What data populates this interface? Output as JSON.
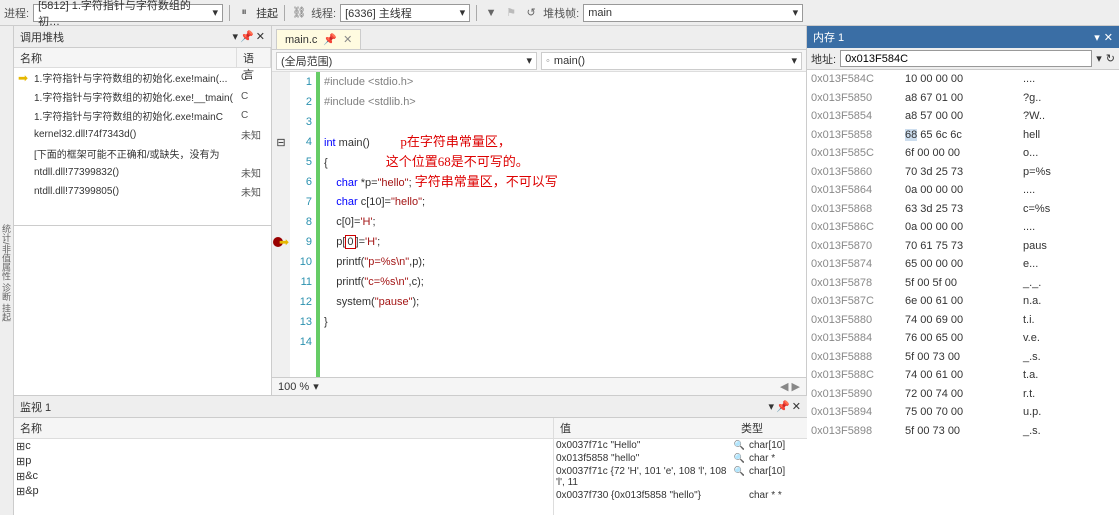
{
  "toolbar": {
    "process_lbl": "进程:",
    "process": "[5812] 1.字符指针与字符数组的初…",
    "suspend": "挂起",
    "thread_lbl": "线程:",
    "thread": "[6336] 主线程",
    "stackframe_lbl": "堆栈帧:",
    "stackframe": "main"
  },
  "callstack": {
    "title": "调用堆栈",
    "col_name": "名称",
    "col_lang": "语言",
    "rows": [
      {
        "arrow": "➡",
        "name": "1.字符指针与字符数组的初始化.exe!main(... ",
        "lang": "C"
      },
      {
        "arrow": "",
        "name": "1.字符指针与字符数组的初始化.exe!__tmain(",
        "lang": "C"
      },
      {
        "arrow": "",
        "name": "1.字符指针与字符数组的初始化.exe!mainC",
        "lang": "C"
      },
      {
        "arrow": "",
        "name": "kernel32.dll!74f7343d()",
        "lang": "未知"
      },
      {
        "arrow": "",
        "name": "[下面的框架可能不正确和/或缺失，没有为",
        "lang": ""
      },
      {
        "arrow": "",
        "name": "ntdll.dll!77399832()",
        "lang": "未知"
      },
      {
        "arrow": "",
        "name": "ntdll.dll!77399805()",
        "lang": "未知"
      }
    ]
  },
  "editor": {
    "tab": "main.c",
    "scope_global": "(全局范围)",
    "scope_func": "main()",
    "zoom": "100 %",
    "lines": [
      {
        "n": 1,
        "html": "<span class='pp'>#include &lt;stdio.h&gt;</span>"
      },
      {
        "n": 2,
        "html": "<span class='pp'>#include &lt;stdlib.h&gt;</span>"
      },
      {
        "n": 3,
        "html": ""
      },
      {
        "n": 4,
        "html": "<span class='kw'>int</span> main()          <span class='annot'>p在字符串常量区，</span>",
        "mark": "-"
      },
      {
        "n": 5,
        "html": "{                   <span class='annot'>这个位置68是不可写的。</span>"
      },
      {
        "n": 6,
        "html": "    <span class='kw'>char</span> *p=<span class='str'>\"hello\"</span>; <span class='annot'>字符串常量区，不可以写</span>"
      },
      {
        "n": 7,
        "html": "    <span class='kw'>char</span> c[10]=<span class='str'>\"hello\"</span>;"
      },
      {
        "n": 8,
        "html": "    c[0]=<span class='str'>'H'</span>;"
      },
      {
        "n": 9,
        "html": "    p[<span class='box'>0</span>]=<span class='str'>'H'</span>;",
        "mark": "bp"
      },
      {
        "n": 10,
        "html": "    printf(<span class='str'>\"p=%s\\n\"</span>,p);"
      },
      {
        "n": 11,
        "html": "    printf(<span class='str'>\"c=%s\\n\"</span>,c);"
      },
      {
        "n": 12,
        "html": "    system(<span class='str'>\"pause\"</span>);"
      },
      {
        "n": 13,
        "html": "}"
      },
      {
        "n": 14,
        "html": ""
      }
    ]
  },
  "watch": {
    "title": "监视 1",
    "col_name": "名称",
    "col_value": "值",
    "col_type": "类型",
    "rows": [
      {
        "name": "c",
        "value": "0x0037f71c \"Hello\"",
        "type": "char[10]",
        "s": "🔍"
      },
      {
        "name": "p",
        "value": "0x013f5858 \"hello\"",
        "type": "char *",
        "s": "🔍"
      },
      {
        "name": "&c",
        "value": "0x0037f71c {72 'H', 101 'e', 108 'l', 108 'l', 11",
        "type": "char[10]",
        "s": "🔍"
      },
      {
        "name": "&p",
        "value": "0x0037f730 {0x013f5858 \"hello\"}",
        "type": "char * *"
      }
    ]
  },
  "memory": {
    "title": "内存 1",
    "addr_lbl": "地址:",
    "addr": "0x013F584C",
    "rows": [
      {
        "a": "0x013F584C",
        "h": "10 00 00 00",
        "t": "...."
      },
      {
        "a": "0x013F5850",
        "h": "a8 67 01 00",
        "t": "?g.."
      },
      {
        "a": "0x013F5854",
        "h": "a8 57 00 00",
        "t": "?W.."
      },
      {
        "a": "0x013F5858",
        "h": "68 65 6c 6c",
        "t": "hell",
        "hl": 0
      },
      {
        "a": "0x013F585C",
        "h": "6f 00 00 00",
        "t": "o..."
      },
      {
        "a": "0x013F5860",
        "h": "70 3d 25 73",
        "t": "p=%s"
      },
      {
        "a": "0x013F5864",
        "h": "0a 00 00 00",
        "t": "...."
      },
      {
        "a": "0x013F5868",
        "h": "63 3d 25 73",
        "t": "c=%s"
      },
      {
        "a": "0x013F586C",
        "h": "0a 00 00 00",
        "t": "...."
      },
      {
        "a": "0x013F5870",
        "h": "70 61 75 73",
        "t": "paus"
      },
      {
        "a": "0x013F5874",
        "h": "65 00 00 00",
        "t": "e..."
      },
      {
        "a": "0x013F5878",
        "h": "5f 00 5f 00",
        "t": "_._."
      },
      {
        "a": "0x013F587C",
        "h": "6e 00 61 00",
        "t": "n.a."
      },
      {
        "a": "0x013F5880",
        "h": "74 00 69 00",
        "t": "t.i."
      },
      {
        "a": "0x013F5884",
        "h": "76 00 65 00",
        "t": "v.e."
      },
      {
        "a": "0x013F5888",
        "h": "5f 00 73 00",
        "t": "_.s."
      },
      {
        "a": "0x013F588C",
        "h": "74 00 61 00",
        "t": "t.a."
      },
      {
        "a": "0x013F5890",
        "h": "72 00 74 00",
        "t": "r.t."
      },
      {
        "a": "0x013F5894",
        "h": "75 00 70 00",
        "t": "u.p."
      },
      {
        "a": "0x013F5898",
        "h": "5f 00 73 00",
        "t": "_.s."
      }
    ]
  }
}
